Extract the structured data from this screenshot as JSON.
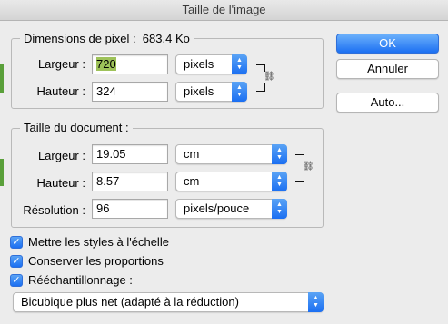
{
  "window": {
    "title": "Taille de l'image"
  },
  "pixel_dimensions": {
    "legend": "Dimensions de pixel :",
    "size": "683.4 Ko",
    "width_label": "Largeur :",
    "width_value": "720",
    "width_unit": "pixels",
    "height_label": "Hauteur :",
    "height_value": "324",
    "height_unit": "pixels"
  },
  "document_size": {
    "legend": "Taille du document :",
    "width_label": "Largeur :",
    "width_value": "19.05",
    "width_unit": "cm",
    "height_label": "Hauteur :",
    "height_value": "8.57",
    "height_unit": "cm",
    "resolution_label": "Résolution :",
    "resolution_value": "96",
    "resolution_unit": "pixels/pouce"
  },
  "buttons": {
    "ok": "OK",
    "cancel": "Annuler",
    "auto": "Auto..."
  },
  "options": {
    "scale_styles": "Mettre les styles à l'échelle",
    "constrain_proportions": "Conserver les proportions",
    "resample": "Rééchantillonnage :",
    "resample_method": "Bicubique plus net (adapté à la réduction)"
  },
  "colors": {
    "accent": "#1b6ff2",
    "selection": "#9ec25a"
  },
  "icons": {
    "link": "chain-link-icon",
    "popup": "up-down-chevron-icon",
    "check": "checkmark-icon"
  }
}
